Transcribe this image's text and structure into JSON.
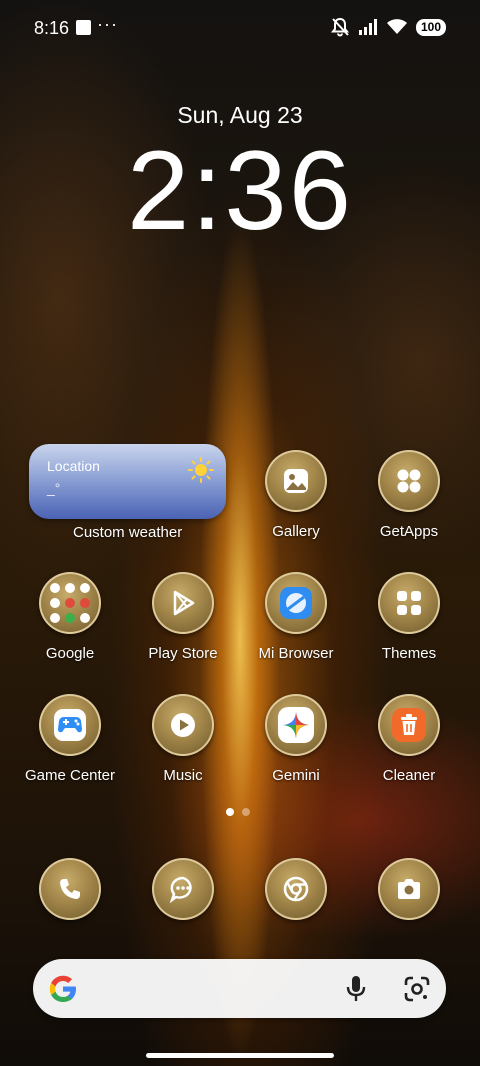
{
  "status_bar": {
    "time": "8:16",
    "dots": "···",
    "battery": "100"
  },
  "lock": {
    "date": "Sun, Aug 23",
    "time": "2:36"
  },
  "weather_widget": {
    "location": "Location",
    "temperature": "_°",
    "label": "Custom weather",
    "icon": "sun-icon"
  },
  "apps_row1": [
    {
      "label": "Gallery",
      "icon": "gallery-icon"
    },
    {
      "label": "GetApps",
      "icon": "getapps-icon"
    }
  ],
  "apps_row2": [
    {
      "label": "Google",
      "icon": "folder-icon"
    },
    {
      "label": "Play Store",
      "icon": "play-store-icon"
    },
    {
      "label": "Mi Browser",
      "icon": "browser-icon"
    },
    {
      "label": "Themes",
      "icon": "themes-icon"
    }
  ],
  "apps_row3": [
    {
      "label": "Game Center",
      "icon": "gamepad-icon"
    },
    {
      "label": "Music",
      "icon": "music-icon"
    },
    {
      "label": "Gemini",
      "icon": "gemini-icon"
    },
    {
      "label": "Cleaner",
      "icon": "trash-icon"
    }
  ],
  "dock": [
    {
      "name": "Phone",
      "icon": "phone-icon"
    },
    {
      "name": "Messages",
      "icon": "messages-icon"
    },
    {
      "name": "Chrome",
      "icon": "chrome-icon"
    },
    {
      "name": "Camera",
      "icon": "camera-icon"
    }
  ],
  "pages": {
    "count": 2,
    "active": 1
  },
  "colors": {
    "weather_top": "#c9d4ec",
    "weather_bottom": "#4a63b4",
    "icon_gold": "#a2864a",
    "cleaner_orange": "#f26a2a"
  }
}
